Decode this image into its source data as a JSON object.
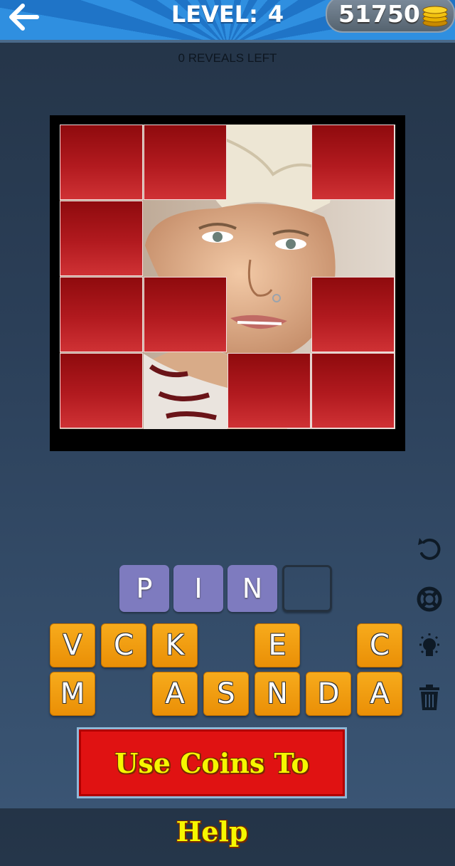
{
  "header": {
    "level_label": "LEVEL:",
    "level_number": "4",
    "coins": "51750"
  },
  "reveals_text": "0 REVEALS LEFT",
  "puzzle": {
    "grid_rows": 4,
    "grid_cols": 4,
    "revealed_tiles": [
      [
        0,
        2
      ],
      [
        1,
        1
      ],
      [
        1,
        2
      ],
      [
        1,
        3
      ],
      [
        2,
        2
      ],
      [
        3,
        1
      ]
    ]
  },
  "answer": {
    "slots": [
      "P",
      "I",
      "N",
      ""
    ]
  },
  "keyboard": {
    "row1": [
      "V",
      "C",
      "K",
      "",
      "E",
      "",
      "C"
    ],
    "row2": [
      "M",
      "",
      "A",
      "S",
      "N",
      "D",
      "A"
    ]
  },
  "banner": {
    "text": "Use Coins To Help"
  },
  "colors": {
    "tile_red": "#b21a1f",
    "key_orange": "#f2a012",
    "slot_purple": "#7e7bbf",
    "banner_red": "#e01212",
    "banner_text": "#f6f700"
  },
  "icons": [
    "back-arrow-icon",
    "coin-stack-icon",
    "undo-icon",
    "lifebuoy-icon",
    "lightbulb-icon",
    "trash-icon"
  ]
}
